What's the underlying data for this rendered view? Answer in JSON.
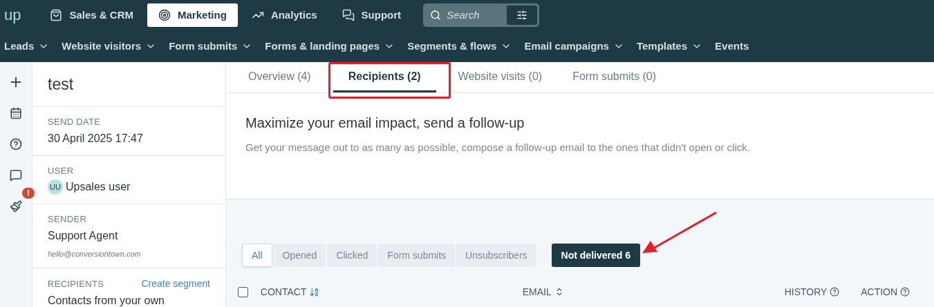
{
  "logo": "up",
  "main_nav": [
    {
      "label": "Sales & CRM",
      "selected": false
    },
    {
      "label": "Marketing",
      "selected": true
    },
    {
      "label": "Analytics",
      "selected": false
    },
    {
      "label": "Support",
      "selected": false
    }
  ],
  "search": {
    "placeholder": "Search"
  },
  "sub_nav": [
    {
      "label": "Leads",
      "dropdown": true
    },
    {
      "label": "Website visitors",
      "dropdown": true
    },
    {
      "label": "Form submits",
      "dropdown": true
    },
    {
      "label": "Forms & landing pages",
      "dropdown": true
    },
    {
      "label": "Segments & flows",
      "dropdown": true
    },
    {
      "label": "Email campaigns",
      "dropdown": true
    },
    {
      "label": "Templates",
      "dropdown": true
    },
    {
      "label": "Events",
      "dropdown": false
    }
  ],
  "rail_alert": "!",
  "details": {
    "title": "test",
    "sections": [
      {
        "kind": "text",
        "label": "SEND DATE",
        "value": "30 April 2025 17:47"
      },
      {
        "kind": "user",
        "label": "USER",
        "initials": "UU",
        "value": "Upsales user"
      },
      {
        "kind": "sender",
        "label": "SENDER",
        "value": "Support Agent",
        "email": "hello@conversiontown.com"
      },
      {
        "kind": "recipients",
        "label": "RECIPIENTS",
        "link": "Create segment",
        "value": "Contacts from your own"
      }
    ]
  },
  "tabs": [
    {
      "label": "Overview (4)",
      "selected": false
    },
    {
      "label": "Recipients (2)",
      "selected": true
    },
    {
      "label": "Website visits (0)",
      "selected": false
    },
    {
      "label": "Form submits (0)",
      "selected": false
    }
  ],
  "promo": {
    "title": "Maximize your email impact, send a follow-up",
    "text": "Get your message out to as many as possible, compose a follow-up email to the ones that didn't open or click."
  },
  "filters": [
    {
      "label": "All",
      "selected": true
    },
    {
      "label": "Opened",
      "selected": false
    },
    {
      "label": "Clicked",
      "selected": false
    },
    {
      "label": "Form submits",
      "selected": false
    },
    {
      "label": "Unsubscribers",
      "selected": false
    }
  ],
  "not_delivered": "Not delivered 6",
  "table": {
    "select_all_checked": false,
    "columns": [
      {
        "label": "CONTACT"
      },
      {
        "label": "EMAIL"
      },
      {
        "label": "HISTORY"
      },
      {
        "label": "ACTION"
      }
    ]
  }
}
